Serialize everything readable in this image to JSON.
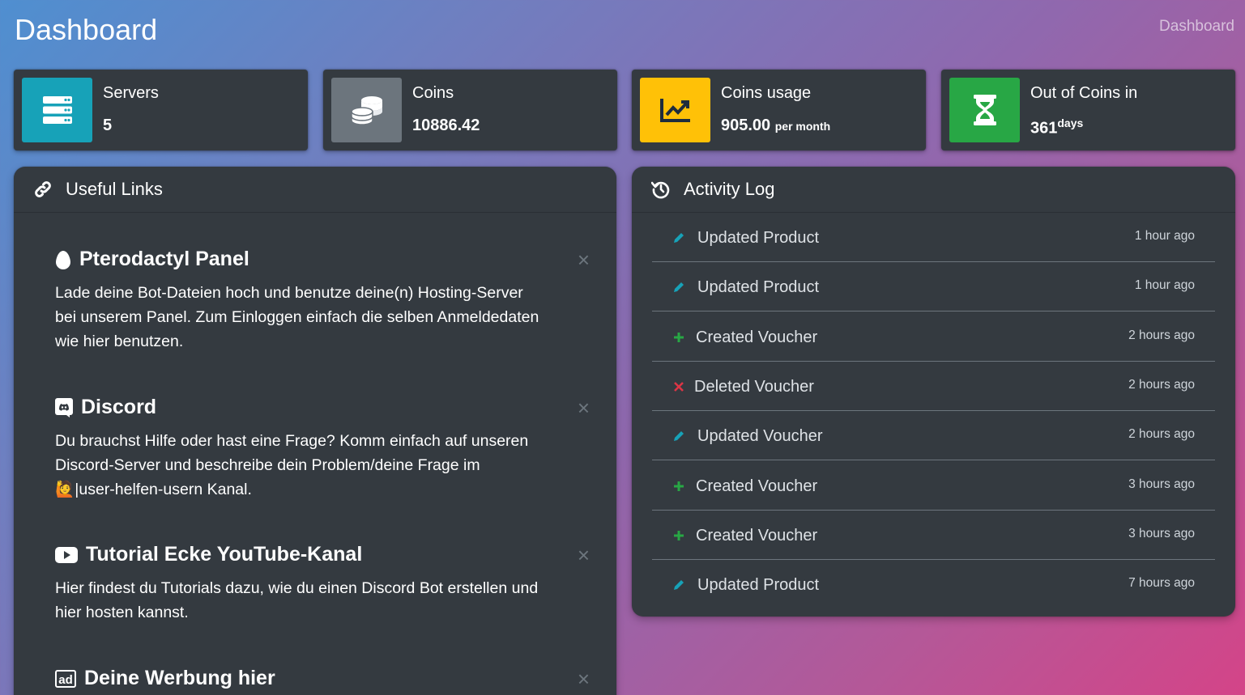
{
  "header": {
    "title": "Dashboard",
    "breadcrumb": "Dashboard"
  },
  "stats": [
    {
      "label": "Servers",
      "value": "5",
      "suffix": "",
      "color": "#17a2b8",
      "icon": "server-icon"
    },
    {
      "label": "Coins",
      "value": "10886.42",
      "suffix": "",
      "color": "#6c757d",
      "icon": "coins-icon"
    },
    {
      "label": "Coins usage",
      "value": "905.00",
      "suffix": "per month",
      "color": "#ffc107",
      "icon": "chart-line-icon"
    },
    {
      "label": "Out of Coins in",
      "value": "361",
      "suffix": "days",
      "color": "#28a745",
      "icon": "hourglass-icon"
    }
  ],
  "links_card": {
    "title": "Useful Links",
    "items": [
      {
        "title": "Pterodactyl Panel",
        "icon": "egg-icon",
        "text": "Lade deine Bot-Dateien hoch und benutze deine(n) Hosting-Server bei unserem Panel. Zum Einloggen einfach die selben Anmeldedaten wie hier benutzen."
      },
      {
        "title": "Discord",
        "icon": "discord-icon",
        "text_before": "Du brauchst Hilfe oder hast eine Frage? Komm einfach auf unseren Discord-Server und beschreibe dein Problem/deine Frage im ",
        "emoji": "🙋",
        "text_after": "|user-helfen-usern Kanal."
      },
      {
        "title": "Tutorial Ecke YouTube-Kanal",
        "icon": "youtube-icon",
        "text": "Hier findest du Tutorials dazu, wie du einen Discord Bot erstellen und hier hosten kannst."
      },
      {
        "title": "Deine Werbung hier",
        "icon": "ad-icon",
        "text": ""
      }
    ],
    "close_glyph": "×"
  },
  "activity_card": {
    "title": "Activity Log",
    "items": [
      {
        "action": "Updated Product",
        "time": "1 hour ago",
        "type": "update"
      },
      {
        "action": "Updated Product",
        "time": "1 hour ago",
        "type": "update"
      },
      {
        "action": "Created Voucher",
        "time": "2 hours ago",
        "type": "create"
      },
      {
        "action": "Deleted Voucher",
        "time": "2 hours ago",
        "type": "delete"
      },
      {
        "action": "Updated Voucher",
        "time": "2 hours ago",
        "type": "update"
      },
      {
        "action": "Created Voucher",
        "time": "3 hours ago",
        "type": "create"
      },
      {
        "action": "Created Voucher",
        "time": "3 hours ago",
        "type": "create"
      },
      {
        "action": "Updated Product",
        "time": "7 hours ago",
        "type": "update"
      }
    ]
  },
  "colors": {
    "update": "#17a2b8",
    "create": "#28a745",
    "delete": "#dc3545"
  }
}
